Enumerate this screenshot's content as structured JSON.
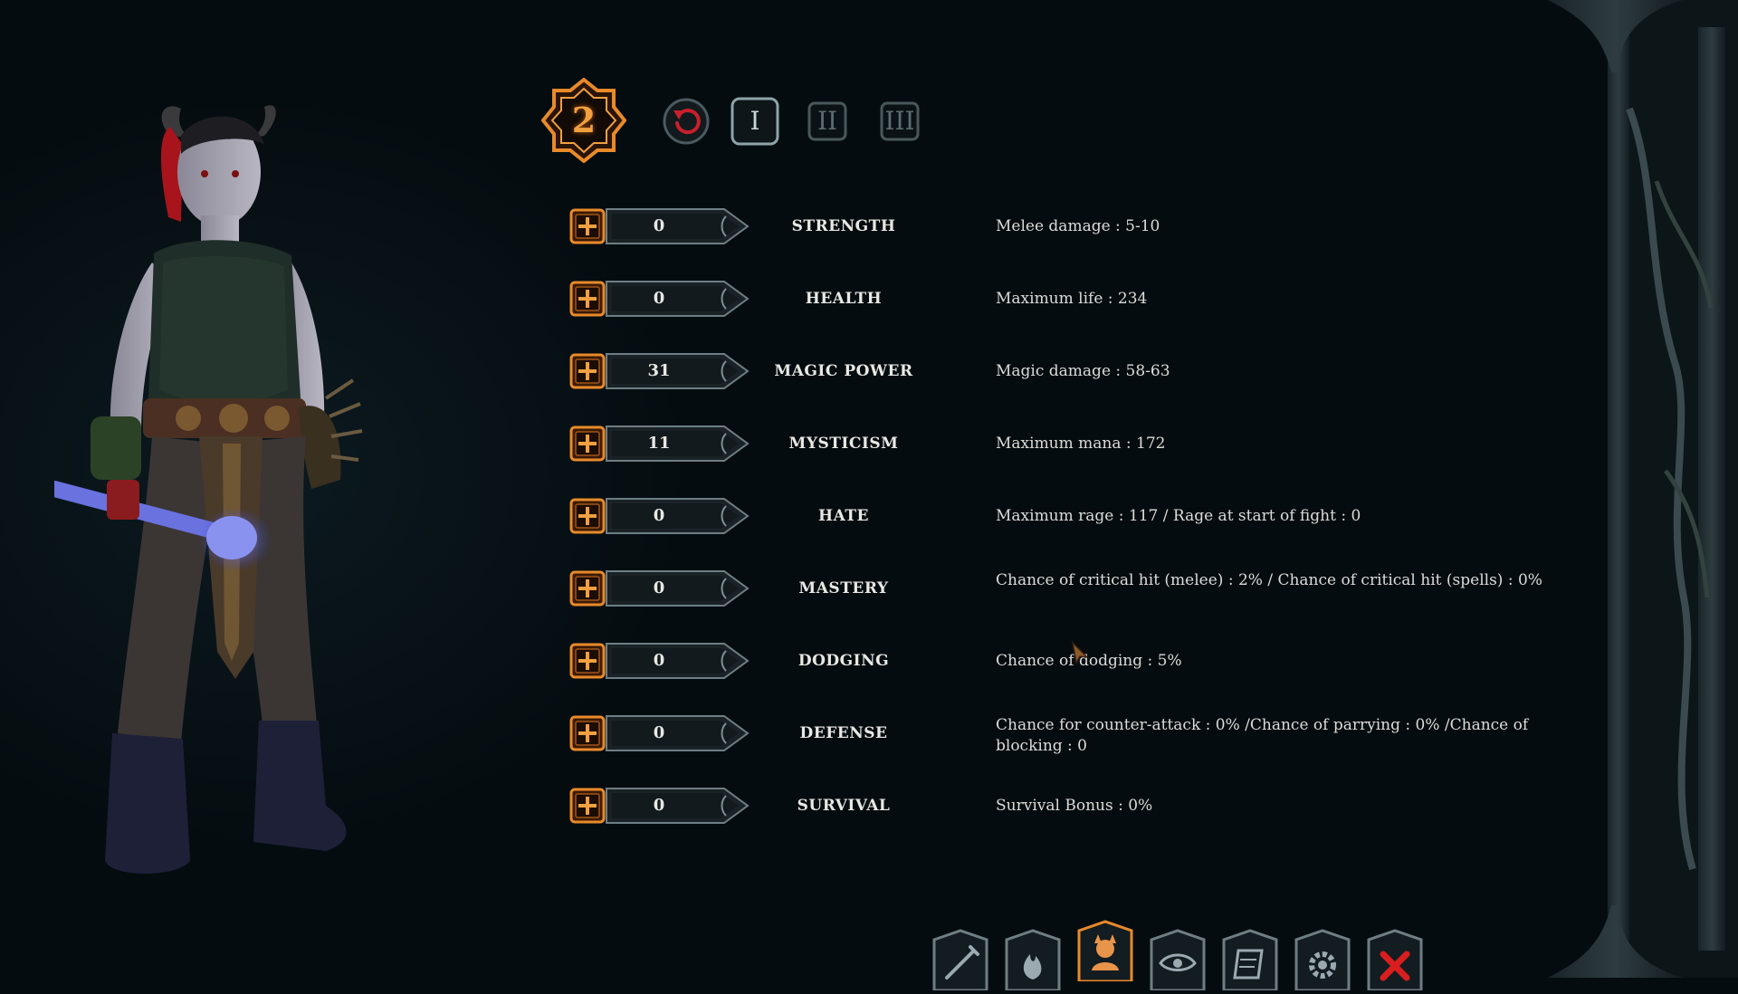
{
  "available_points": "2",
  "tiers": [
    "I",
    "II",
    "III"
  ],
  "stats": [
    {
      "value": "0",
      "name": "STRENGTH",
      "description": "Melee damage : 5-10"
    },
    {
      "value": "0",
      "name": "HEALTH",
      "description": "Maximum life : 234"
    },
    {
      "value": "31",
      "name": "MAGIC POWER",
      "description": "Magic damage : 58-63"
    },
    {
      "value": "11",
      "name": "MYSTICISM",
      "description": "Maximum mana : 172"
    },
    {
      "value": "0",
      "name": "HATE",
      "description": "Maximum rage : 117 / Rage at start of fight : 0"
    },
    {
      "value": "0",
      "name": "MASTERY",
      "description": "Chance of critical hit (melee) : 2% / Chance of critical hit (spells) : 0%"
    },
    {
      "value": "0",
      "name": "DODGING",
      "description": "Chance of dodging : 5%"
    },
    {
      "value": "0",
      "name": "DEFENSE",
      "description": "Chance for counter-attack : 0% /Chance of parrying : 0% /Chance of blocking : 0"
    },
    {
      "value": "0",
      "name": "SURVIVAL",
      "description": "Survival Bonus : 0%"
    }
  ],
  "icons": {
    "reset": "reset-icon",
    "plus": "plus-icon",
    "nav": [
      "sword-icon",
      "fire-icon",
      "character-icon",
      "eye-icon",
      "scroll-icon",
      "gear-icon",
      "close-icon"
    ]
  },
  "colors": {
    "accent": "#e88a2a",
    "background": "#050c10",
    "text": "#dcdcd8",
    "close": "#d81e1e"
  }
}
